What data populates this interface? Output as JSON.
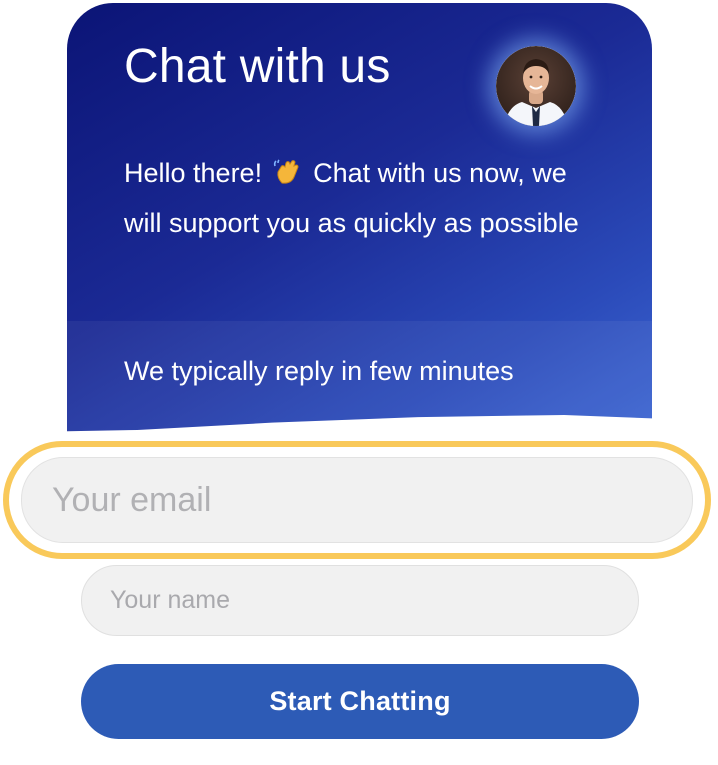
{
  "header": {
    "title": "Chat with us",
    "greeting_before_icon": "Hello there!",
    "greeting_icon": "waving-hand-icon",
    "greeting_after_icon": "Chat with us now, we will support you as quickly as possible",
    "reply_time": "We typically reply in few minutes",
    "avatar": "agent-avatar"
  },
  "form": {
    "email_placeholder": "Your email",
    "email_value": "",
    "name_placeholder": "Your name",
    "name_value": "",
    "submit_label": "Start Chatting"
  },
  "colors": {
    "header_gradient_start": "#0b1476",
    "header_gradient_end": "#3d66d2",
    "focus_ring": "#f9c95a",
    "button": "#2d5bb6",
    "input_bg": "#f1f1f1"
  }
}
